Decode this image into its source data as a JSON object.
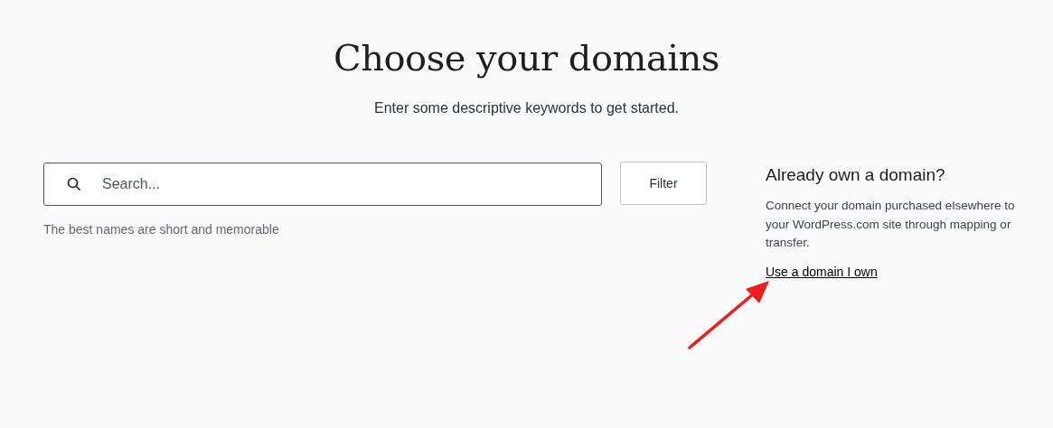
{
  "header": {
    "title": "Choose your domains",
    "subtitle": "Enter some descriptive keywords to get started."
  },
  "search": {
    "placeholder": "Search...",
    "hint": "The best names are short and memorable"
  },
  "filter_button": "Filter",
  "own_domain": {
    "heading": "Already own a domain?",
    "text": "Connect your domain purchased elsewhere to your WordPress.com site through mapping or transfer.",
    "link": "Use a domain I own"
  },
  "annotation": {
    "kind": "arrow"
  }
}
